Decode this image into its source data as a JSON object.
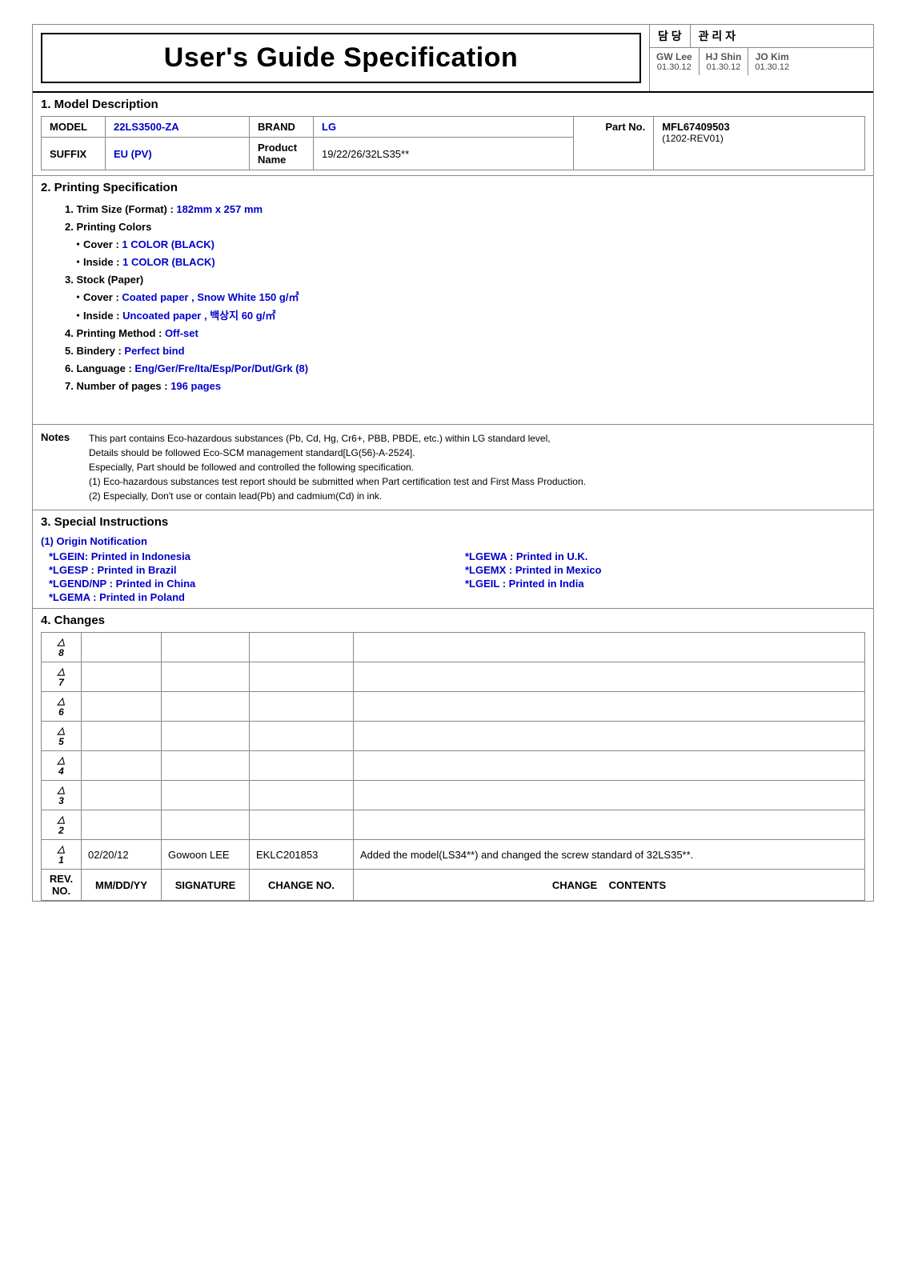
{
  "header": {
    "title": "User's Guide Specification",
    "right_top": {
      "col1": "담 당",
      "col2": "관 리 자"
    },
    "right_bottom": [
      {
        "name": "GW Lee",
        "date": "01.30.12"
      },
      {
        "name": "HJ Shin",
        "date": "01.30.12"
      },
      {
        "name": "JO Kim",
        "date": "01.30.12"
      }
    ]
  },
  "section1": {
    "title": "1.  Model Description",
    "model_label": "MODEL",
    "model_value": "22LS3500-ZA",
    "brand_label": "BRAND",
    "brand_value": "LG",
    "suffix_label": "SUFFIX",
    "suffix_value": "EU (PV)",
    "product_name_label": "Product Name",
    "product_name_value": "19/22/26/32LS35**",
    "part_no_label": "Part No.",
    "part_no_value": "MFL67409503",
    "part_no_sub": "(1202-REV01)"
  },
  "section2": {
    "title": "2.    Printing Specification",
    "items": [
      {
        "num": "1",
        "label": "Trim Size (Format) :",
        "value": "182mm x 257 mm",
        "blue": true
      },
      {
        "num": "2",
        "label": "Printing Colors",
        "value": "",
        "blue": false
      },
      {
        "num": "",
        "sub": "Cover :",
        "subval": "1 COLOR (BLACK)",
        "blue": true
      },
      {
        "num": "",
        "sub": "Inside :",
        "subval": "1 COLOR (BLACK)",
        "blue": true
      },
      {
        "num": "3",
        "label": "Stock (Paper)",
        "value": "",
        "blue": false
      },
      {
        "num": "",
        "sub": "Cover :",
        "subval": "Coated paper , Snow White 150  g/㎡",
        "blue": true
      },
      {
        "num": "",
        "sub": "Inside :",
        "subval": "Uncoated paper , 백상지 60 g/㎡",
        "blue": true
      },
      {
        "num": "4",
        "label": "Printing Method :",
        "value": "Off-set",
        "blue": true
      },
      {
        "num": "5",
        "label": "Bindery  :",
        "value": "Perfect bind",
        "blue": true
      },
      {
        "num": "6",
        "label": "Language :",
        "value": "Eng/Ger/Fre/Ita/Esp/Por/Dut/Grk (8)",
        "blue": true
      },
      {
        "num": "7",
        "label": "Number of pages :",
        "value": "196 pages",
        "blue": true
      }
    ]
  },
  "notes": {
    "label": "Notes",
    "lines": [
      "This part contains Eco-hazardous substances (Pb, Cd, Hg, Cr6+, PBB, PBDE, etc.) within LG standard level,",
      "Details should be followed Eco-SCM management standard[LG(56)-A-2524].",
      "Especially, Part should be followed and controlled the following specification.",
      "(1) Eco-hazardous substances test report should be submitted when  Part certification test and First Mass Production.",
      "(2) Especially, Don't use or contain lead(Pb) and cadmium(Cd) in ink."
    ]
  },
  "section3": {
    "title": "3.    Special Instructions",
    "origin_title": "(1) Origin Notification",
    "origin_items": [
      {
        "code": "*LGEIN:",
        "text": "Printed in Indonesia"
      },
      {
        "code": "*LGEWA :",
        "text": "Printed in U.K."
      },
      {
        "code": "*LGESP :",
        "text": "Printed in Brazil"
      },
      {
        "code": "*LGEMX :",
        "text": "Printed in Mexico"
      },
      {
        "code": "*LGEND/NP :",
        "text": "Printed in China"
      },
      {
        "code": "*LGEIL :",
        "text": "Printed in India"
      },
      {
        "code": "*LGEMA :",
        "text": "Printed in Poland"
      }
    ]
  },
  "section4": {
    "title": "4.    Changes",
    "rows": [
      {
        "rev": "8",
        "date": "",
        "signature": "",
        "change_no": "",
        "contents": ""
      },
      {
        "rev": "7",
        "date": "",
        "signature": "",
        "change_no": "",
        "contents": ""
      },
      {
        "rev": "6",
        "date": "",
        "signature": "",
        "change_no": "",
        "contents": ""
      },
      {
        "rev": "5",
        "date": "",
        "signature": "",
        "change_no": "",
        "contents": ""
      },
      {
        "rev": "4",
        "date": "",
        "signature": "",
        "change_no": "",
        "contents": ""
      },
      {
        "rev": "3",
        "date": "",
        "signature": "",
        "change_no": "",
        "contents": ""
      },
      {
        "rev": "2",
        "date": "",
        "signature": "",
        "change_no": "",
        "contents": ""
      },
      {
        "rev": "1",
        "date": "02/20/12",
        "signature": "Gowoon LEE",
        "change_no": "EKLC201853",
        "contents": "Added the model(LS34**) and changed the screw standard of 32LS35**."
      }
    ],
    "footer": {
      "rev_label": "REV. NO.",
      "date_label": "MM/DD/YY",
      "sig_label": "SIGNATURE",
      "chno_label": "CHANGE NO.",
      "change_label": "CHANGE",
      "contents_label": "CONTENTS"
    }
  }
}
